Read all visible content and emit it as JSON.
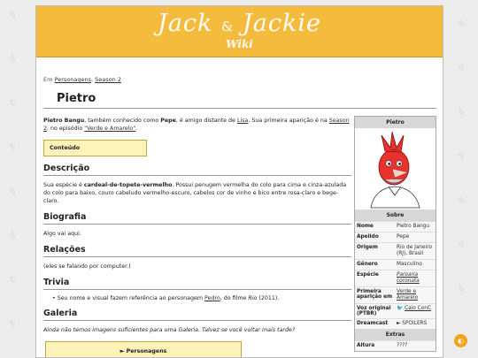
{
  "banner": {
    "logo_left": "Jack",
    "logo_amp": "&",
    "logo_right": "Jackie",
    "logo_sub": "Wiki"
  },
  "breadcrumb": {
    "prefix": "Em",
    "items": [
      "Personagens",
      "Season 2"
    ],
    "separator": ","
  },
  "page": {
    "title": "Pietro"
  },
  "intro": {
    "name_bold": "Pietro Bangu",
    "text1": ", também conhecido como ",
    "nick_bold": "Pepe",
    "text2": ", é amigo distante de ",
    "link_lisa": "Lisa",
    "text3": ". Sua primeira aparição é na ",
    "link_season": "Season 2",
    "text4": ", no episódio ",
    "link_episode": "\"Verde e Amarelo\"",
    "text5": "."
  },
  "toc": {
    "label": "Conteúdo"
  },
  "sections": {
    "descricao": {
      "heading": "Descrição",
      "text1": "Sua espécie é ",
      "species_bold": "cardeal-de-topete-vermelho",
      "text2": ". Possui penugem vermelha do colo para cima e cinza-azulada do colo para baixo, couro cabeludo vermelho-escuro, cabelos cor de vinho e bico entre rosa-claro e bege-claro."
    },
    "biografia": {
      "heading": "Biografia",
      "text": "Algo vai aqui."
    },
    "relacoes": {
      "heading": "Relações",
      "text": "(eles se falando por computer.)"
    },
    "trivia": {
      "heading": "Trivia",
      "text1": "Seu nome e visual fazem referência ao personagem ",
      "link": "Pedro",
      "text2": ", do filme ",
      "film": "Rio",
      "text3": " (2011)."
    },
    "galeria": {
      "heading": "Galeria",
      "text": "Ainda não temos imagens suficientes para uma Galeria. Talvez se você voltar mais tarde?"
    }
  },
  "collapse": {
    "label": "► Personagens"
  },
  "infobox": {
    "title": "Pietro",
    "about_header": "Sobre",
    "rows": [
      {
        "key": "Nome",
        "value": "Pietro Bangu"
      },
      {
        "key": "Apelido",
        "value": "Pepe"
      },
      {
        "key": "Origem",
        "value": "Rio de Janeiro (RJ), Brasil"
      },
      {
        "key": "Gênero",
        "value": "Masculino"
      },
      {
        "key": "Espécie",
        "value": "Paroaria coronata"
      },
      {
        "key": "Primeira aparição em",
        "value": "Verde e Amarelo"
      },
      {
        "key": "Voz original (PTBR)",
        "value": "Caio ConC"
      },
      {
        "key": "Dreamcast",
        "value": "► SPOILERS"
      }
    ],
    "extras_header": "Extras",
    "extra_rows": [
      {
        "key": "Altura",
        "value": "????"
      }
    ]
  },
  "colors": {
    "banner": "#f5bb3d",
    "accent_box": "#fdf2b8",
    "bird_red": "#e8322e",
    "fab": "#f5a21b"
  },
  "icons": {
    "twitter": "twitter-icon",
    "theme_toggle": "half-circle-icon"
  }
}
